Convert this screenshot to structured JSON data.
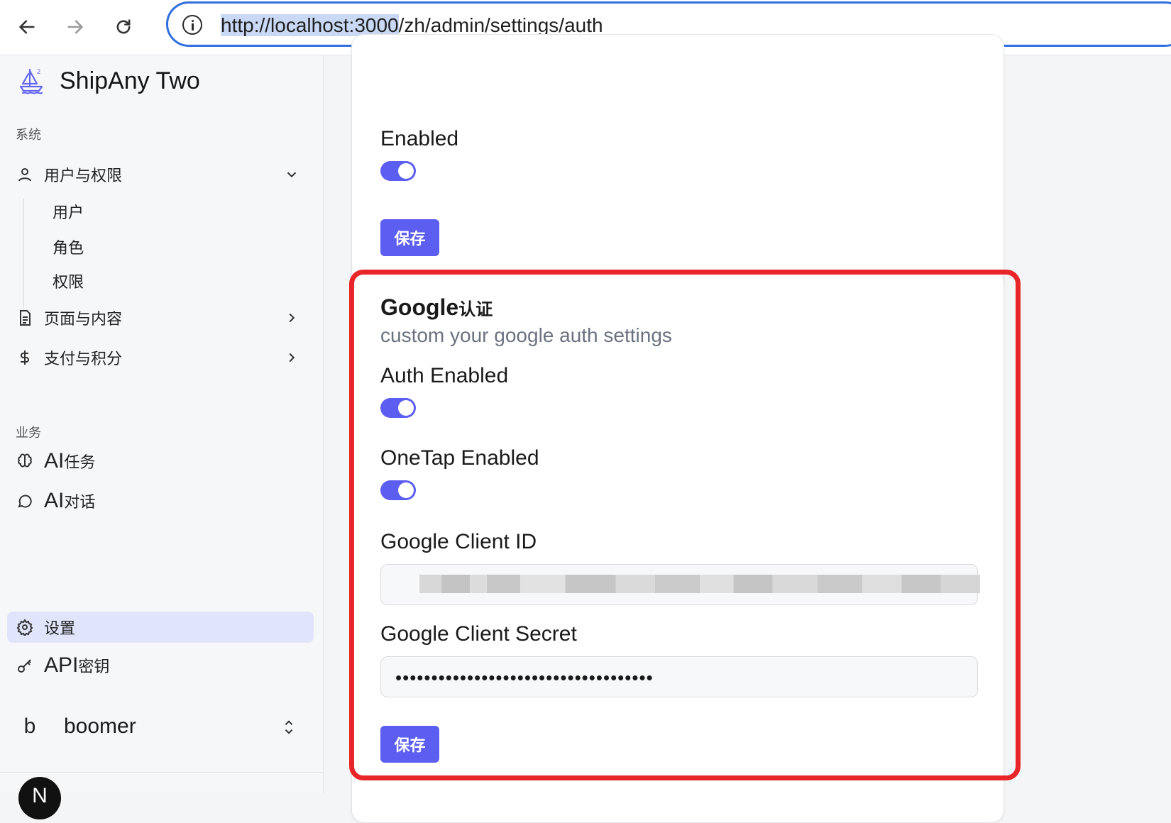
{
  "browser": {
    "url_host": "http://localhost:3000",
    "url_path": "/zh/admin/settings/auth"
  },
  "sidebar": {
    "brand": "ShipAny Two",
    "group_system": "系统",
    "users_perms": "用户与权限",
    "sub_users": "用户",
    "sub_roles": "角色",
    "sub_perms": "权限",
    "pages_content": "页面与内容",
    "payments_credits": "支付与积分",
    "group_business": "业务",
    "ai_tasks_prefix": "AI",
    "ai_tasks_suffix": "任务",
    "ai_chat_prefix": "AI",
    "ai_chat_suffix": " 对话",
    "settings": "设置",
    "api_prefix": "API",
    "api_suffix": "密钥",
    "user_initial": "b",
    "user_name": "boomer",
    "next_badge": "N"
  },
  "card1": {
    "label": "Enabled",
    "save": "保存"
  },
  "card2": {
    "title_main": "Google",
    "title_zh": "认证",
    "desc": "custom your google auth settings",
    "auth_enabled": "Auth Enabled",
    "onetap_enabled": "OneTap Enabled",
    "client_id_label": "Google Client ID",
    "client_secret_label": "Google Client Secret",
    "client_secret_value": "••••••••••••••••••••••••••••••••••••",
    "save": "保存"
  },
  "colors": {
    "accent": "#5b5ef0",
    "highlight": "#e8262a",
    "url_focus": "#2f6fde"
  }
}
